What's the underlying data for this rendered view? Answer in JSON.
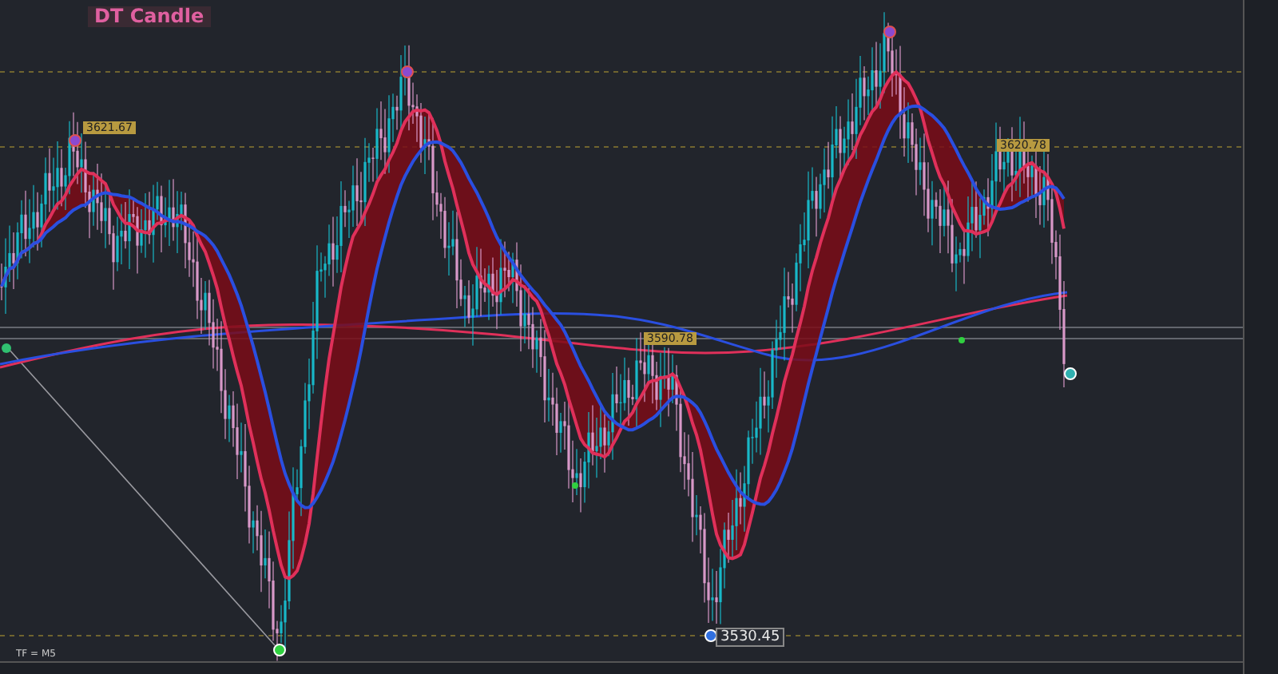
{
  "indicator": {
    "title": "DT Candle"
  },
  "price_labels": [
    {
      "text": "3621.67",
      "kind": "high"
    },
    {
      "text": "3620.78",
      "kind": "high"
    },
    {
      "text": "3590.78",
      "kind": "high"
    },
    {
      "text": "3530.45",
      "kind": "low"
    }
  ],
  "timeframe": "TF = M5"
}
